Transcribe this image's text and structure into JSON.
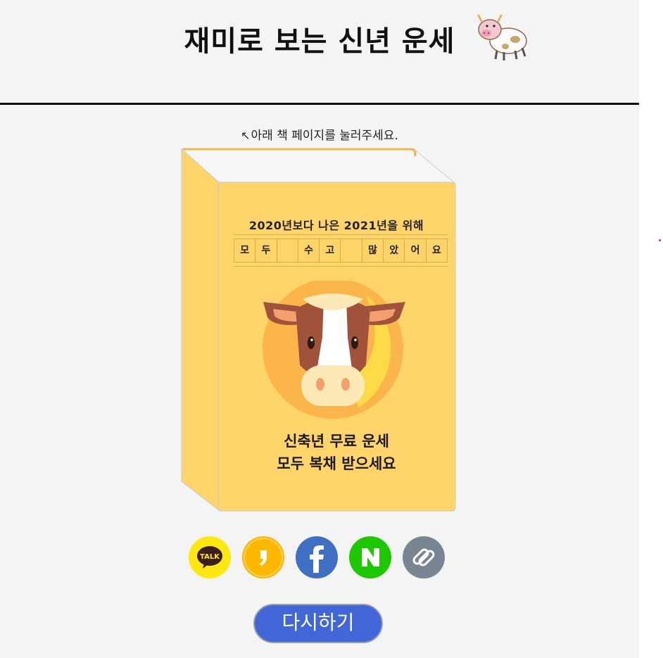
{
  "header": {
    "title": "재미로 보는 신년 운세"
  },
  "hint": {
    "arrow": "↖",
    "text": "아래 책 페이지를 눌러주세요."
  },
  "book": {
    "subtitle": "2020년보다 나은 2021년을 위해",
    "grid_cells": [
      "모",
      "두",
      "",
      "수",
      "고",
      "",
      "많",
      "았",
      "어",
      "요"
    ],
    "line1": "신축년 무료 운세",
    "line2": "모두 복채 받으세요"
  },
  "share": {
    "kakaotalk_label": "TALK",
    "colors": {
      "kakaotalk": "#ffe812",
      "kakaostory": "#ffb400",
      "facebook": "#3f6fc4",
      "naver": "#1ec800",
      "link": "#7a8594"
    }
  },
  "actions": {
    "retry_label": "다시하기"
  },
  "colors": {
    "book": "#ffd46a",
    "background": "#f4f4f4",
    "retry": "#4066d8"
  }
}
